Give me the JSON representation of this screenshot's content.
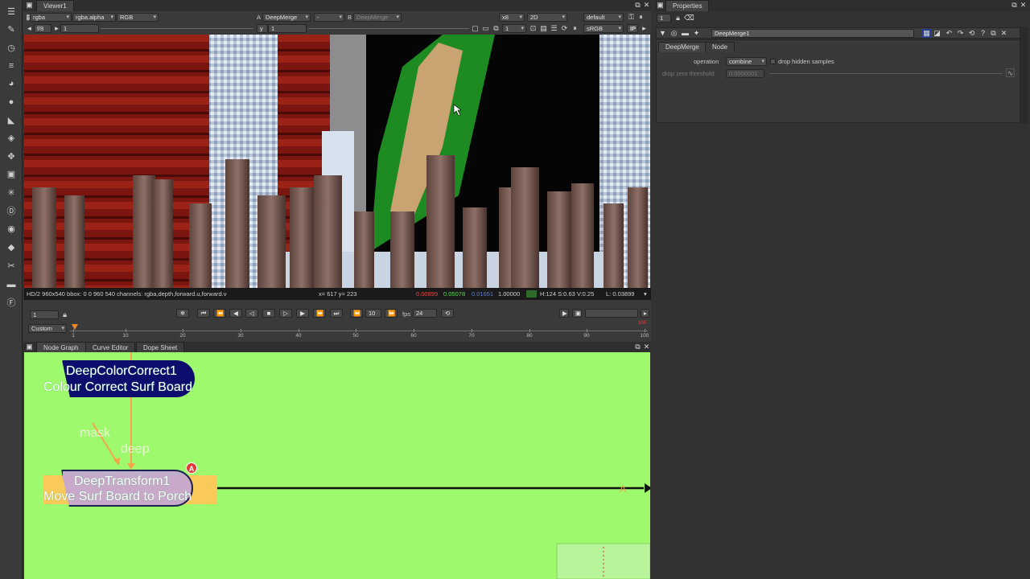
{
  "viewer": {
    "tab": "Viewer1",
    "channels": "rgba",
    "layer": "rgba.alpha",
    "display": "RGB",
    "input_a_label": "A",
    "input_a": "DeepMerge",
    "composite": "-",
    "input_b_label": "B",
    "input_b": "DeepMerge",
    "zoom": "x8",
    "view_mode": "2D",
    "lut": "default",
    "gamma_label": "f/8",
    "gain_value": "1",
    "y_label": "y",
    "y_value": "1",
    "proxy": "1",
    "colorspace": "sRGB",
    "ip_label": "IP",
    "status_left": "HD/2 960x540  bbox: 0 0 960 540  channels: rgba,depth,forward.u,forward.v",
    "coords": "x= 617 y= 223",
    "r_value": "0.00899",
    "g_value": "0.05078",
    "b_value": "0.01651",
    "a_value": "1.00000",
    "hsv": "H:124 S:0.63 V:0.25",
    "luminance": "L: 0.03899",
    "swatch_color": "#2e6b2a"
  },
  "playback": {
    "frame": "1",
    "step_frames": "10",
    "fps_label": "fps",
    "fps_value": "24",
    "range_mode": "Custom",
    "range_end_marker": "100",
    "ticks": [
      "1",
      "10",
      "20",
      "30",
      "40",
      "50",
      "60",
      "70",
      "80",
      "90",
      "100"
    ]
  },
  "bottom_tabs": [
    "Node Graph",
    "Curve Editor",
    "Dope Sheet"
  ],
  "nodegraph": {
    "bg_color": "#9ef96d",
    "node1_line1": "DeepColorCorrect1",
    "node1_line2": "Colour Correct Surf Board",
    "edge_mask": "mask",
    "edge_deep": "deep",
    "node2_line1": "DeepTransform1",
    "node2_line2": "Move Surf Board to Porch",
    "badge": "A",
    "arrow_label": "A"
  },
  "properties": {
    "title": "Properties",
    "count": "1",
    "node_name": "DeepMerge1",
    "tabs": [
      "DeepMerge",
      "Node"
    ],
    "operation_label": "operation",
    "operation_value": "combine",
    "drop_hidden_label": "drop hidden samples",
    "threshold_label": "drop zero threshold",
    "threshold_value": "0.0000001"
  },
  "icons": {
    "toolbar": [
      "pane-menu-icon",
      "paint-icon",
      "time-icon",
      "channel-icon",
      "color-icon",
      "filter-icon",
      "draw-icon",
      "layers-icon",
      "transform-icon",
      "3d-icon",
      "particles-icon",
      "deep-icon",
      "views-icon",
      "metadata-icon",
      "toolsets-icon",
      "other-icon",
      "furnace-icon"
    ]
  }
}
